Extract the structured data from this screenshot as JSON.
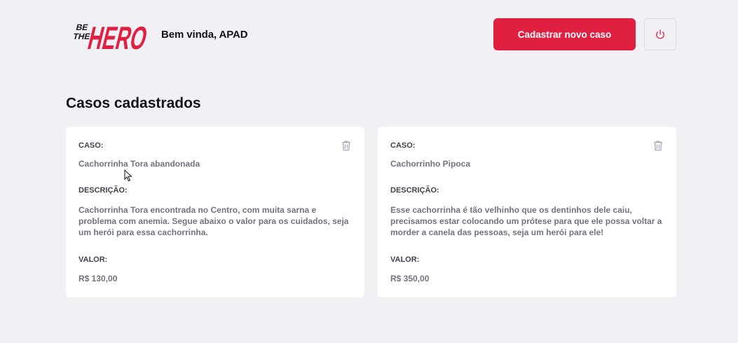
{
  "header": {
    "logo_text": [
      "BE",
      "THE",
      "HERO"
    ],
    "welcome": "Bem vinda, APAD",
    "new_case_label": "Cadastrar novo caso",
    "logout_icon": "power-icon"
  },
  "page": {
    "title": "Casos cadastrados"
  },
  "labels": {
    "case": "CASO:",
    "description": "DESCRIÇÃO:",
    "value": "VALOR:"
  },
  "cases": [
    {
      "title": "Cachorrinha Tora abandonada",
      "description": "Cachorrinha Tora encontrada no Centro, com muita sarna e problema com anemia. Segue abaixo o valor para os cuidados, seja um herói para essa cachorrinha.",
      "value": "R$ 130,00"
    },
    {
      "title": "Cachorrinho Pipoca",
      "description": "Esse cachorrinha é tão velhinho que os dentinhos dele caiu, precisamos estar colocando um prótese para que ele possa voltar a morder a canela das pessoas, seja um herói para ele!",
      "value": "R$ 350,00"
    }
  ],
  "colors": {
    "accent": "#e02041",
    "background": "#f0f0f5",
    "card": "#ffffff",
    "text_muted": "#737380"
  }
}
